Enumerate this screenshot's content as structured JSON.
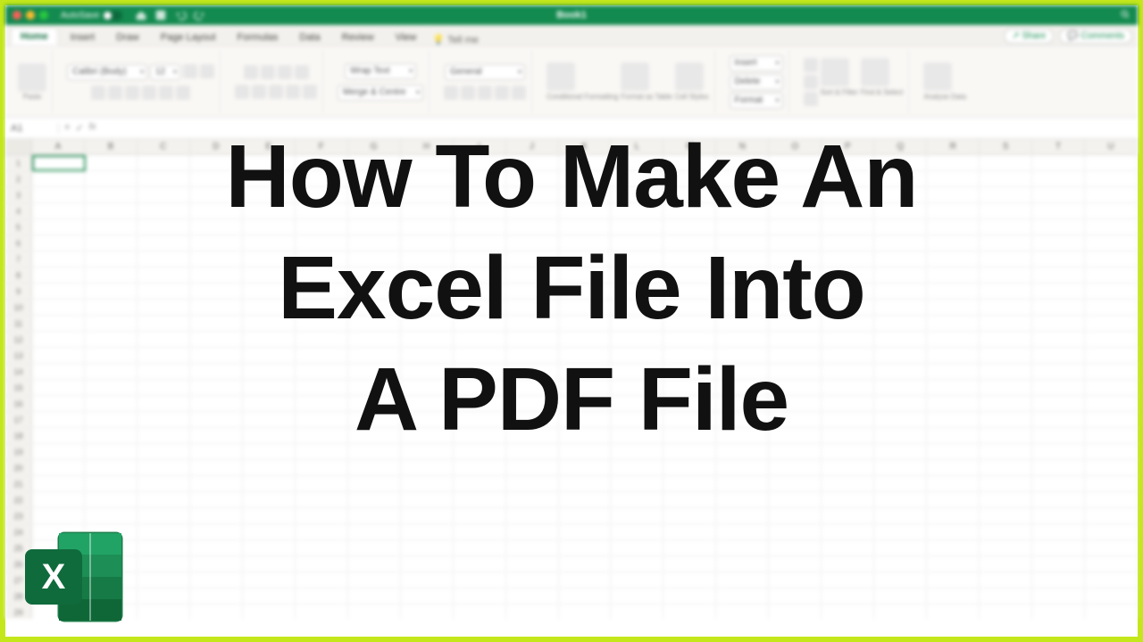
{
  "window": {
    "autosave_label": "AutoSave",
    "title": "Book1"
  },
  "tabs": {
    "items": [
      "Home",
      "Insert",
      "Draw",
      "Page Layout",
      "Formulas",
      "Data",
      "Review",
      "View"
    ],
    "active": "Home",
    "tellme": "Tell me",
    "share": "Share",
    "comments": "Comments"
  },
  "ribbon": {
    "paste": "Paste",
    "font_name": "Calibri (Body)",
    "font_size": "12",
    "wrap": "Wrap Text",
    "merge": "Merge & Centre",
    "number_format": "General",
    "cond": "Conditional Formatting",
    "as_table": "Format as Table",
    "styles": "Cell Styles",
    "insert": "Insert",
    "delete": "Delete",
    "format": "Format",
    "sort": "Sort & Filter",
    "find": "Find & Select",
    "analyse": "Analyse Data"
  },
  "formula": {
    "name": "A1",
    "fx": "fx"
  },
  "columns": [
    "A",
    "B",
    "C",
    "D",
    "E",
    "F",
    "G",
    "H",
    "I",
    "J",
    "K",
    "L",
    "M",
    "N",
    "O",
    "P",
    "Q",
    "R",
    "S",
    "T",
    "U"
  ],
  "overlay": {
    "line1": "How To Make An",
    "line2": "Excel File Into",
    "line3": "A PDF File"
  },
  "logo_letter": "X"
}
